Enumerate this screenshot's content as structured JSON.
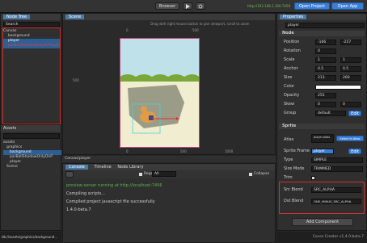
{
  "toolbar": {
    "browser_label": "Browser",
    "play_icon": "play-icon",
    "refresh_icon": "refresh-icon",
    "url_text": "http://192.168.1.100:7456",
    "open_project": "Open Project",
    "open_app": "Open App"
  },
  "node_tree": {
    "title": "Node Tree",
    "search_placeholder": "Search",
    "items": [
      "Canvas",
      "background",
      "player",
      "parBallShadowOnlyOnPlayer"
    ]
  },
  "assets": {
    "title": "Assets",
    "items": [
      "assets",
      "graphics",
      "background",
      "parBallShadowOnlyOnP",
      "player",
      "Scene"
    ],
    "path": "db://assets/graphics/background..."
  },
  "scene": {
    "title": "Scene",
    "hint": "Drag with right mouse button to pan viewport, scroll to zoom",
    "axis_top": [
      "0",
      "500"
    ],
    "axis_left": "500",
    "axis_bottom": [
      "0",
      "500",
      "1000"
    ],
    "breadcrumb": "Canvas/player"
  },
  "console": {
    "tabs": [
      "Console",
      "Timeline",
      "Node Library"
    ],
    "regex_label": "Regex",
    "filter_value": "All",
    "collapse_label": "Collapse",
    "lines": [
      "preview-server running at http://localhost:7456",
      "Compiling scripts...",
      "Compiled project javascript file successfully",
      "1.4.0-beta.7"
    ]
  },
  "properties": {
    "title": "Properties",
    "node_name": "player",
    "node_section": "Node",
    "fields": [
      {
        "label": "Position",
        "x": "-166",
        "y": "-257"
      },
      {
        "label": "Rotation",
        "v": "0"
      },
      {
        "label": "Scale",
        "x": "1",
        "y": "1"
      },
      {
        "label": "Anchor",
        "x": "0.5",
        "y": "0.5"
      },
      {
        "label": "Size",
        "x": "213",
        "y": "260"
      },
      {
        "label": "Color",
        "v": ""
      },
      {
        "label": "Opacity",
        "v": "255"
      },
      {
        "label": "Skew",
        "x": "0",
        "y": "0"
      },
      {
        "label": "Group",
        "v": "default"
      }
    ],
    "edit_label": "Edit",
    "sprite_section": "Sprite",
    "atlas_label": "Atlas",
    "atlas_value": "player.altas",
    "select_atlas": "Select In Atlas",
    "sprite_frame_label": "Sprite Frame",
    "sprite_frame_value": "player",
    "type_label": "Type",
    "type_value": "SIMPLE",
    "size_mode_label": "Size Mode",
    "size_mode_value": "TRIMMED",
    "trim_label": "Trim",
    "src_blend_label": "Src Blend",
    "src_blend_value": "SRC_ALPHA",
    "dst_blend_label": "Dst Blend",
    "dst_blend_value": "ONE_MINUS_SRC_ALPHA",
    "add_component": "Add Component"
  },
  "footer": {
    "version": "Cocos Creator v1.4.0-beta.7"
  },
  "colors": {
    "accent": "#3a7fd6",
    "highlight_red": "#e04040",
    "ground_green": "#79a83a",
    "sky_blue": "#bfe1ea"
  }
}
